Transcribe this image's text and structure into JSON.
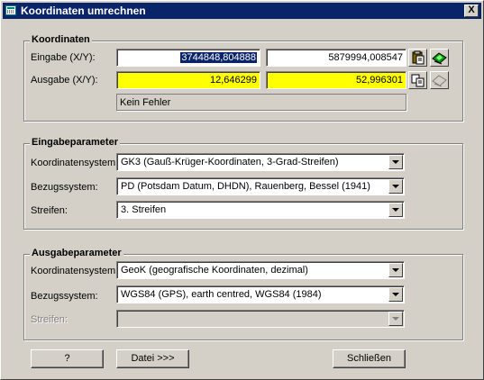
{
  "window": {
    "title": "Koordinaten umrechnen",
    "close_glyph": "X"
  },
  "coordinates": {
    "group_title": "Koordinaten",
    "input_label": "Eingabe (X/Y):",
    "input_x": "3744848,804888",
    "input_y": "5879994,008547",
    "output_label": "Ausgabe (X/Y):",
    "output_x": "12,646299",
    "output_y": "52,996301",
    "status": "Kein Fehler",
    "highlight_color": "#ffff00"
  },
  "input_params": {
    "group_title": "Eingabeparameter",
    "system_label": "Koordinatensystem:",
    "system_value": "GK3 (Gauß-Krüger-Koordinaten, 3-Grad-Streifen)",
    "datum_label": "Bezugssystem:",
    "datum_value": "PD (Potsdam Datum, DHDN), Rauenberg, Bessel (1941)",
    "strip_label": "Streifen:",
    "strip_value": "3. Streifen"
  },
  "output_params": {
    "group_title": "Ausgabeparameter",
    "system_label": "Koordinatensystem:",
    "system_value": "GeoK (geografische Koordinaten, dezimal)",
    "datum_label": "Bezugssystem:",
    "datum_value": "WGS84 (GPS), earth centred, WGS84 (1984)",
    "strip_label": "Streifen:",
    "strip_value": ""
  },
  "buttons": {
    "help": "?",
    "file": "Datei >>>",
    "close": "Schließen"
  },
  "icons": [
    "paste-icon",
    "map-icon",
    "copy-icon",
    "map-icon-disabled"
  ]
}
